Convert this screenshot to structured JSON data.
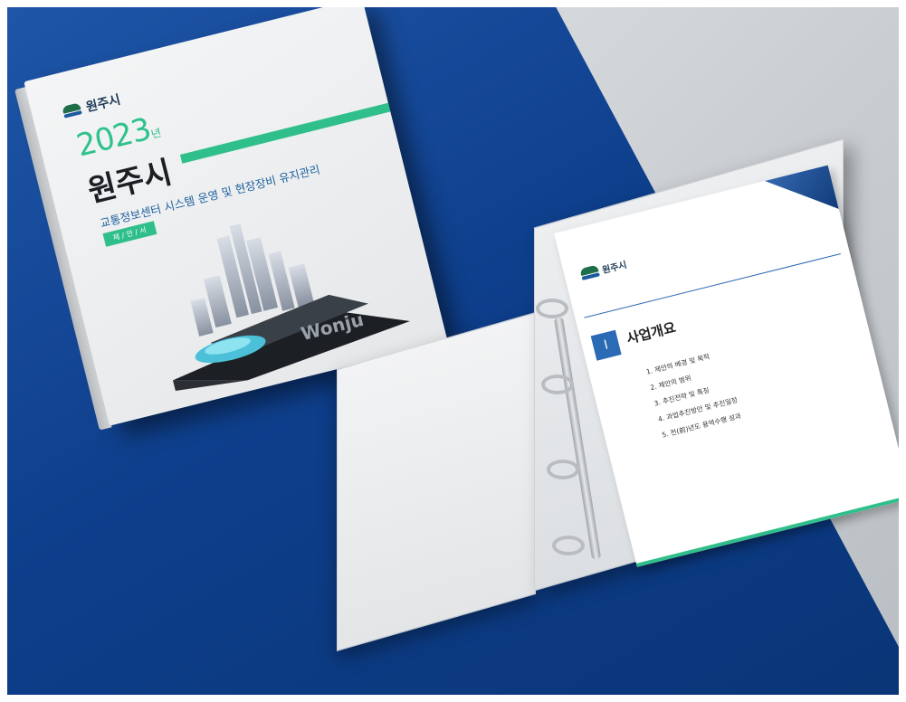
{
  "cover": {
    "logo_text": "원주시",
    "year": "2023",
    "year_suffix": "년",
    "city": "원주시",
    "subtitle": "교통정보센터 시스템 운영 및 현장장비 유지관리",
    "tag": "제 / 안 / 서",
    "art_word": "Wonju"
  },
  "page": {
    "logo_text": "원주시",
    "title": "사업개요",
    "items": [
      "1. 제안의 배경 및 목적",
      "2. 제안의 범위",
      "3. 추진전략 및 특징",
      "4. 과업추진방안 및 추진일정",
      "5. 전(前)년도 용역수행 성과"
    ]
  },
  "colors": {
    "accent_green": "#2fbf8a",
    "brand_blue": "#1f56a8",
    "text_dark": "#1b1f24"
  }
}
